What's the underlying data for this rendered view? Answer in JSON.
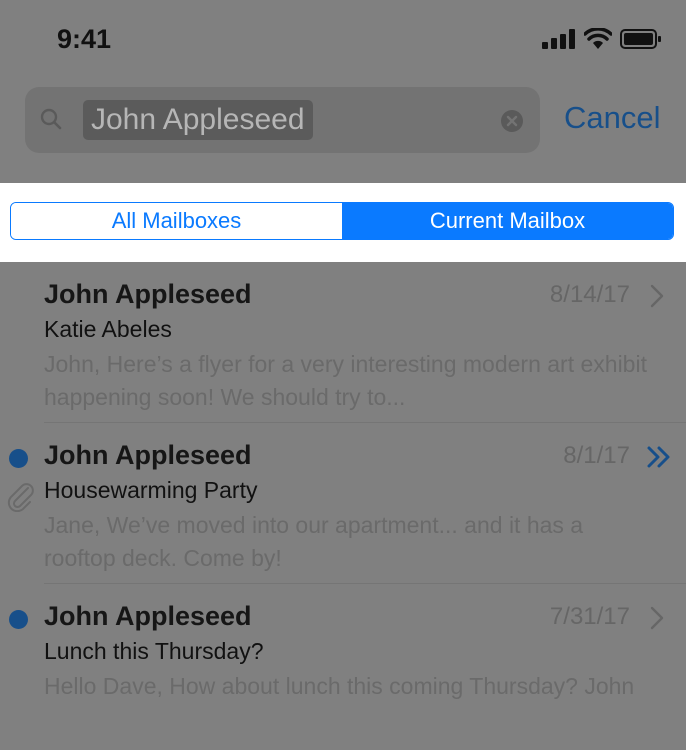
{
  "status_bar": {
    "time": "9:41"
  },
  "search": {
    "query": "John Appleseed",
    "cancel_label": "Cancel"
  },
  "scope": {
    "options": [
      "All Mailboxes",
      "Current Mailbox"
    ],
    "selected": "Current Mailbox",
    "accent_color": "#0a7aff"
  },
  "messages": [
    {
      "sender": "John Appleseed",
      "date": "8/14/17",
      "subject": "Katie Abeles",
      "preview": "John, Here’s a flyer for a very interesting modern art exhibit happening soon! We should try to...",
      "unread": false,
      "attachment": false,
      "action_icon": "chevron-right-icon"
    },
    {
      "sender": "John Appleseed",
      "date": "8/1/17",
      "subject": "Housewarming Party",
      "preview": "Jane, We’ve moved into our apartment... and it has a rooftop deck. Come by!",
      "unread": true,
      "attachment": true,
      "action_icon": "double-chevron-right-icon"
    },
    {
      "sender": "John Appleseed",
      "date": "7/31/17",
      "subject": "Lunch this Thursday?",
      "preview": "Hello Dave, How about lunch this coming Thursday? John",
      "unread": true,
      "attachment": false,
      "action_icon": "chevron-right-icon"
    }
  ]
}
